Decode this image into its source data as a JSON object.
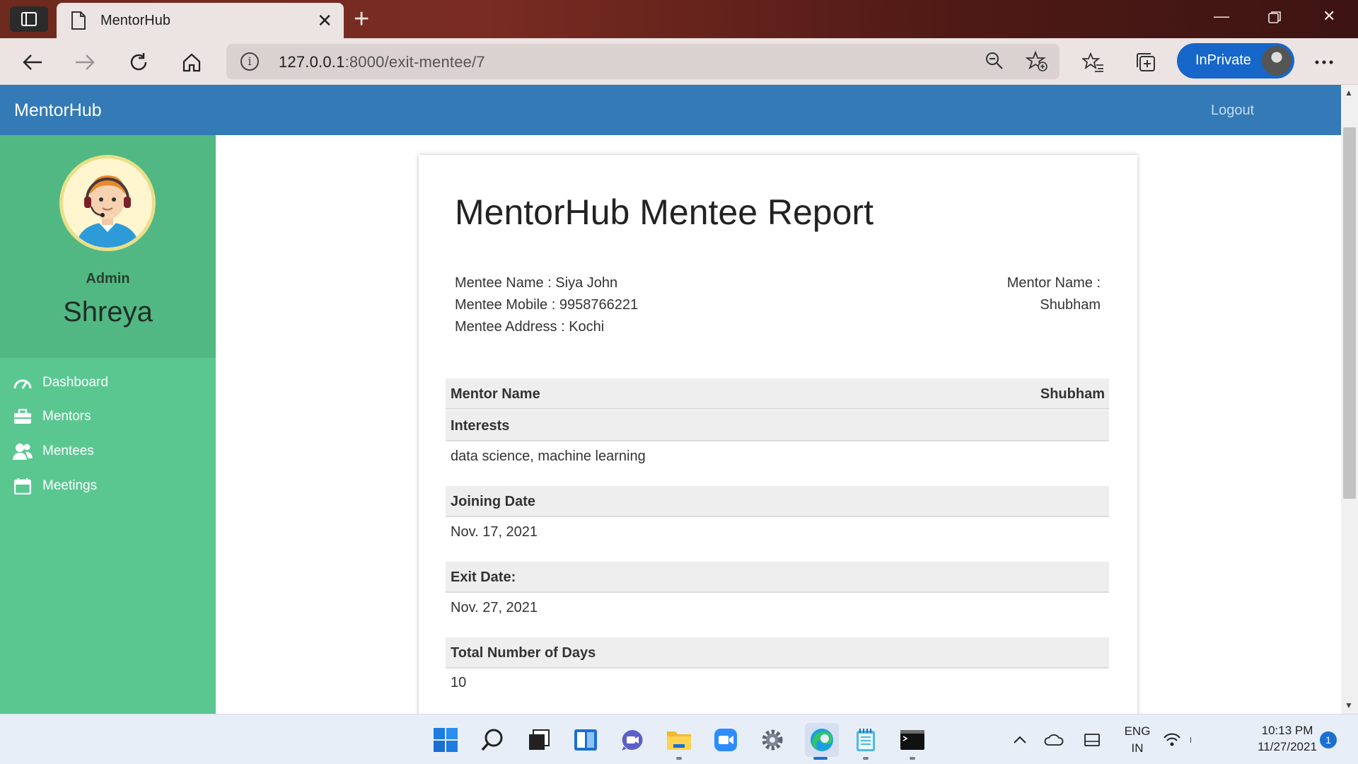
{
  "browser": {
    "tab_title": "MentorHub",
    "url_host": "127.0.0.1",
    "url_rest": ":8000/exit-mentee/7",
    "inprivate_label": "InPrivate"
  },
  "navbar": {
    "brand": "MentorHub",
    "logout": "Logout"
  },
  "sidebar": {
    "role": "Admin",
    "user_name": "Shreya",
    "items": [
      {
        "label": "Dashboard",
        "icon": "gauge-icon"
      },
      {
        "label": "Mentors",
        "icon": "briefcase-icon"
      },
      {
        "label": "Mentees",
        "icon": "users-icon"
      },
      {
        "label": "Meetings",
        "icon": "calendar-icon"
      }
    ]
  },
  "report": {
    "title": "MentorHub Mentee Report",
    "mentee_name": "Mentee Name : Siya John",
    "mentee_mobile": "Mentee Mobile : 9958766221",
    "mentee_address": "Mentee Address : Kochi",
    "mentor_name_label": "Mentor Name :",
    "mentor_name_value": "Shubham",
    "rows": {
      "mentor": {
        "label": "Mentor Name",
        "value": "Shubham"
      },
      "interests": {
        "label": "Interests",
        "value": "data science, machine learning"
      },
      "joining": {
        "label": "Joining Date",
        "value": "Nov. 17, 2021"
      },
      "exit": {
        "label": "Exit Date:",
        "value": "Nov. 27, 2021"
      },
      "days": {
        "label": "Total Number of Days",
        "value": "10"
      }
    }
  },
  "taskbar": {
    "lang_top": "ENG",
    "lang_bottom": "IN",
    "time": "10:13 PM",
    "date": "11/27/2021",
    "notifications": "1"
  }
}
